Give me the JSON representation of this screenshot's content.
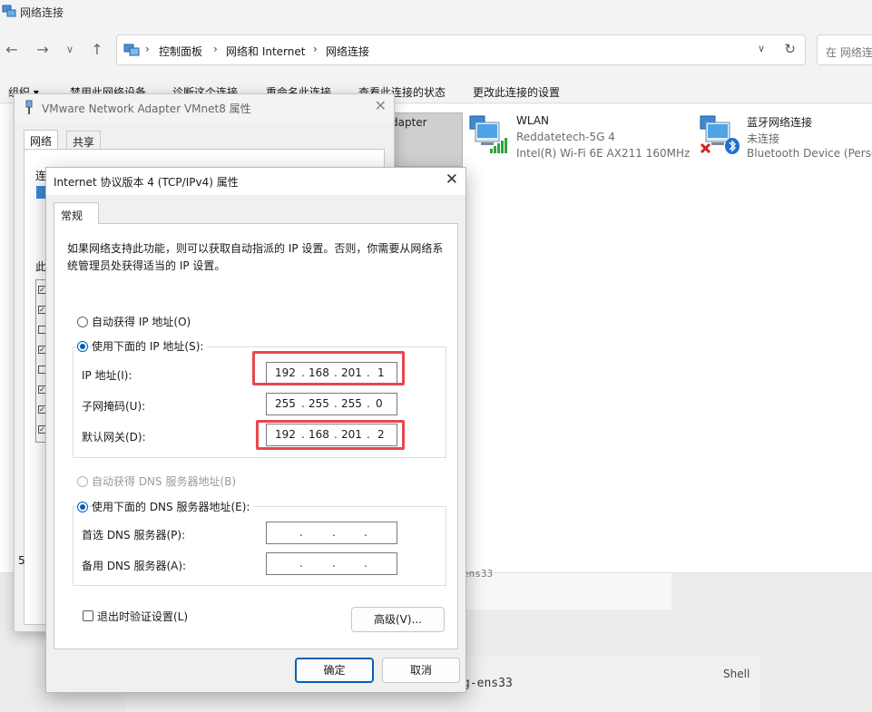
{
  "explorer": {
    "window_title": "网络连接",
    "address": {
      "crumbs": [
        "控制面板",
        "网络和 Internet",
        "网络连接"
      ]
    },
    "search_placeholder": "在 网络连接",
    "commands": [
      "组织 ▾",
      "禁用此网络设备",
      "诊断这个连接",
      "重命名此连接",
      "查看此连接的状态",
      "更改此连接的设置"
    ],
    "selected_adapter_fragment": "dapter",
    "adapters": [
      {
        "name": "WLAN",
        "status": "Reddatetech-5G 4",
        "device": "Intel(R) Wi-Fi 6E AX211 160MHz",
        "icon": "wifi-adapter-icon"
      },
      {
        "name": "蓝牙网络连接",
        "status": "未连接",
        "device": "Bluetooth Device (Perso",
        "icon": "bluetooth-adapter-icon"
      }
    ]
  },
  "background": {
    "fragment_1": "ens33",
    "fragment_2": "g-ens33",
    "shell_label": "Shell"
  },
  "adapter_dialog": {
    "title": "VMware Network Adapter VMnet8 属性",
    "tabs": [
      "网络",
      "共享"
    ],
    "peek_1": "连",
    "peek_2": "此",
    "peek_3": "5"
  },
  "ipv4_dialog": {
    "title": "Internet 协议版本 4 (TCP/IPv4) 属性",
    "tab": "常规",
    "description": "如果网络支持此功能，则可以获取自动指派的 IP 设置。否则，你需要从网络系统管理员处获得适当的 IP 设置。",
    "auto_ip_label": "自动获得 IP 地址(O)",
    "manual_ip_label": "使用下面的 IP 地址(S):",
    "ip_label": "IP 地址(I):",
    "ip_octets": [
      "192",
      "168",
      "201",
      "1"
    ],
    "mask_label": "子网掩码(U):",
    "mask_octets": [
      "255",
      "255",
      "255",
      "0"
    ],
    "gateway_label": "默认网关(D):",
    "gateway_octets": [
      "192",
      "168",
      "201",
      "2"
    ],
    "auto_dns_label": "自动获得 DNS 服务器地址(B)",
    "manual_dns_label": "使用下面的 DNS 服务器地址(E):",
    "preferred_dns_label": "首选 DNS 服务器(P):",
    "alternate_dns_label": "备用 DNS 服务器(A):",
    "validate_label": "退出时验证设置(L)",
    "advanced_button": "高级(V)...",
    "ok_button": "确定",
    "cancel_button": "取消",
    "highlight_color": "#e5484d"
  }
}
